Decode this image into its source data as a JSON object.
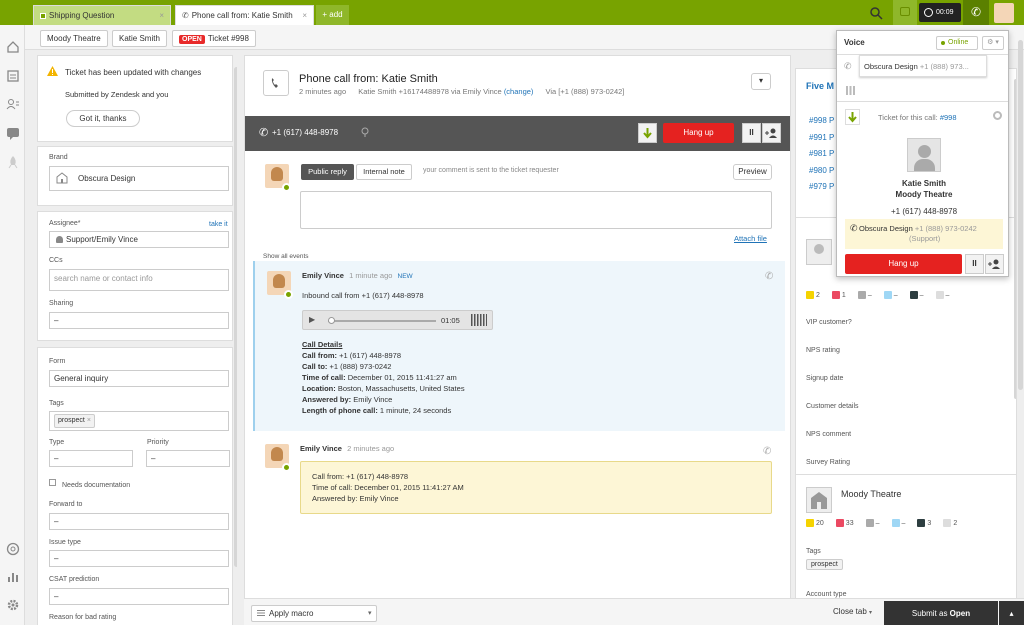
{
  "tabs": [
    {
      "label": "Shipping Question"
    },
    {
      "label": "Phone call from: Katie Smith"
    }
  ],
  "add_tab_label": "+ add",
  "topbar": {
    "timer": "00:09"
  },
  "breadcrumbs": [
    {
      "label": "Moody Theatre"
    },
    {
      "label": "Katie Smith"
    },
    {
      "badge": "OPEN",
      "label": "Ticket #998"
    }
  ],
  "notice": {
    "title": "Ticket has been updated with changes",
    "body": "Submitted by Zendesk and you",
    "button": "Got it, thanks"
  },
  "fields": {
    "brand_label": "Brand",
    "brand_value": "Obscura Design",
    "assignee_label": "Assignee*",
    "take_it": "take it",
    "assignee_value": "Support/Emily Vince",
    "ccs_label": "CCs",
    "ccs_placeholder": "search name or contact info",
    "sharing_label": "Sharing",
    "sharing_value": "–",
    "form_label": "Form",
    "form_value": "General inquiry",
    "tags_label": "Tags",
    "tag": "prospect",
    "type_label": "Type",
    "type_value": "–",
    "priority_label": "Priority",
    "priority_value": "–",
    "needs_doc_label": "Needs documentation",
    "forward_label": "Forward to",
    "forward_value": "–",
    "issue_label": "Issue type",
    "issue_value": "–",
    "csat_label": "CSAT prediction",
    "csat_value": "–",
    "bad_rating_label": "Reason for bad rating"
  },
  "ticket": {
    "title": "Phone call from: Katie Smith",
    "time": "2 minutes ago",
    "meta": "Katie Smith +16174488978 via Emily Vince",
    "change": "(change)",
    "via": "Via [+1 (888) 973-0242]"
  },
  "callbar": {
    "phone": "+1 (617) 448-8978",
    "hangup": "Hang up"
  },
  "composer": {
    "public_reply": "Public reply",
    "internal_note": "Internal note",
    "hint": "your comment is sent to the ticket requester",
    "preview": "Preview",
    "attach": "Attach file",
    "show_all": "Show all events"
  },
  "event1": {
    "author": "Emily Vince",
    "time": "1 minute ago",
    "new": "NEW",
    "text": "Inbound call from +1 (617) 448-8978",
    "audio_time": "01:05",
    "details_title": "Call Details",
    "rows": [
      {
        "k": "Call from:",
        "v": " +1 (617) 448-8978"
      },
      {
        "k": "Call to:",
        "v": " +1 (888) 973-0242"
      },
      {
        "k": "Time of call:",
        "v": " December 01, 2015 11:41:27 am"
      },
      {
        "k": "Location:",
        "v": " Boston, Massachusetts, United States"
      },
      {
        "k": "Answered by:",
        "v": " Emily Vince"
      },
      {
        "k": "Length of phone call:",
        "v": " 1 minute, 24 seconds"
      }
    ]
  },
  "event2": {
    "author": "Emily Vince",
    "time": "2 minutes ago",
    "lines": [
      "Call from: +1 (617) 448-8978",
      "Time of call: December 01, 2015 11:41:27 AM",
      "Answered by: Emily Vince"
    ]
  },
  "right": {
    "five_header": "Five M",
    "tickets": [
      "#998 P",
      "#991 P",
      "#981 P",
      "#980 P",
      "#979 P"
    ],
    "user_stats": [
      {
        "n": "2",
        "c": "#f5d300"
      },
      {
        "n": "1",
        "c": "#eb4962"
      },
      {
        "n": "–",
        "c": "#aaa"
      },
      {
        "n": "–",
        "c": "#9fd7f5"
      },
      {
        "n": "–",
        "c": "#2d3e40"
      },
      {
        "n": "–",
        "c": "#ddd"
      }
    ],
    "user_fields": [
      "VIP customer?",
      "NPS rating",
      "Signup date",
      "Customer details",
      "NPS comment",
      "Survey Rating"
    ],
    "org_name": "Moody Theatre",
    "org_stats": [
      {
        "n": "20",
        "c": "#f5d300"
      },
      {
        "n": "33",
        "c": "#eb4962"
      },
      {
        "n": "–",
        "c": "#aaa"
      },
      {
        "n": "–",
        "c": "#9fd7f5"
      },
      {
        "n": "3",
        "c": "#2d3e40"
      },
      {
        "n": "2",
        "c": "#ddd"
      }
    ],
    "tags_label": "Tags",
    "tag": "prospect",
    "account_type": "Account type"
  },
  "voice": {
    "title": "Voice",
    "status": "Online",
    "line": "Obscura Design",
    "line_phone": "+1 (888) 973...",
    "ticket_text": "Ticket for this call:",
    "ticket_link": "#998",
    "caller": "Katie Smith",
    "caller_org": "Moody Theatre",
    "caller_phone": "+1 (617) 448-8978",
    "via_name": "Obscura Design",
    "via_phone": "+1 (888) 973-0242",
    "via_group": "(Support)",
    "hangup": "Hang up"
  },
  "bottom": {
    "apply_macro": "Apply macro",
    "close_tab": "Close tab",
    "submit_prefix": "Submit as ",
    "submit_status": "Open"
  },
  "colors": {
    "brand": "#78a300",
    "hangup": "#e52220",
    "link": "#1f73b7"
  }
}
